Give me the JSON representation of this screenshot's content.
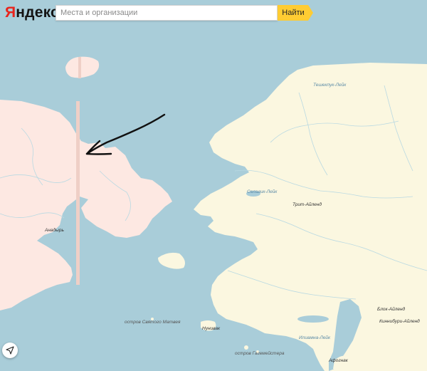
{
  "header": {
    "logo_first": "Я",
    "logo_rest": "ндекс",
    "search_placeholder": "Места и организации",
    "search_value": "",
    "search_button": "Найти"
  },
  "map": {
    "colors": {
      "water": "#a9cdd9",
      "russia_land": "#fde8e2",
      "alaska_land": "#fbf7e0",
      "river": "#b9d9e2",
      "border_band": "#efcfc6",
      "arrow": "#111111"
    },
    "labels": {
      "teshekpuk": "Тешекпук-Лейк",
      "selawik": "Селавик-Лейк",
      "trit": "Трит-Айленд",
      "anadyr": "Анадырь",
      "matthew": "остров Святого Матвея",
      "nunivak": "Нунивак",
      "iliamna": "Илиамна-Лейк",
      "blok": "Блок-Айленд",
      "kinnibury": "Киннибури-Айленд",
      "afognak": "Афогнак",
      "gagemeister": "остров Гагемейстера"
    },
    "annotation": "hand-drawn-arrow"
  },
  "controls": {
    "locate_icon": "navigation-arrow-icon"
  }
}
